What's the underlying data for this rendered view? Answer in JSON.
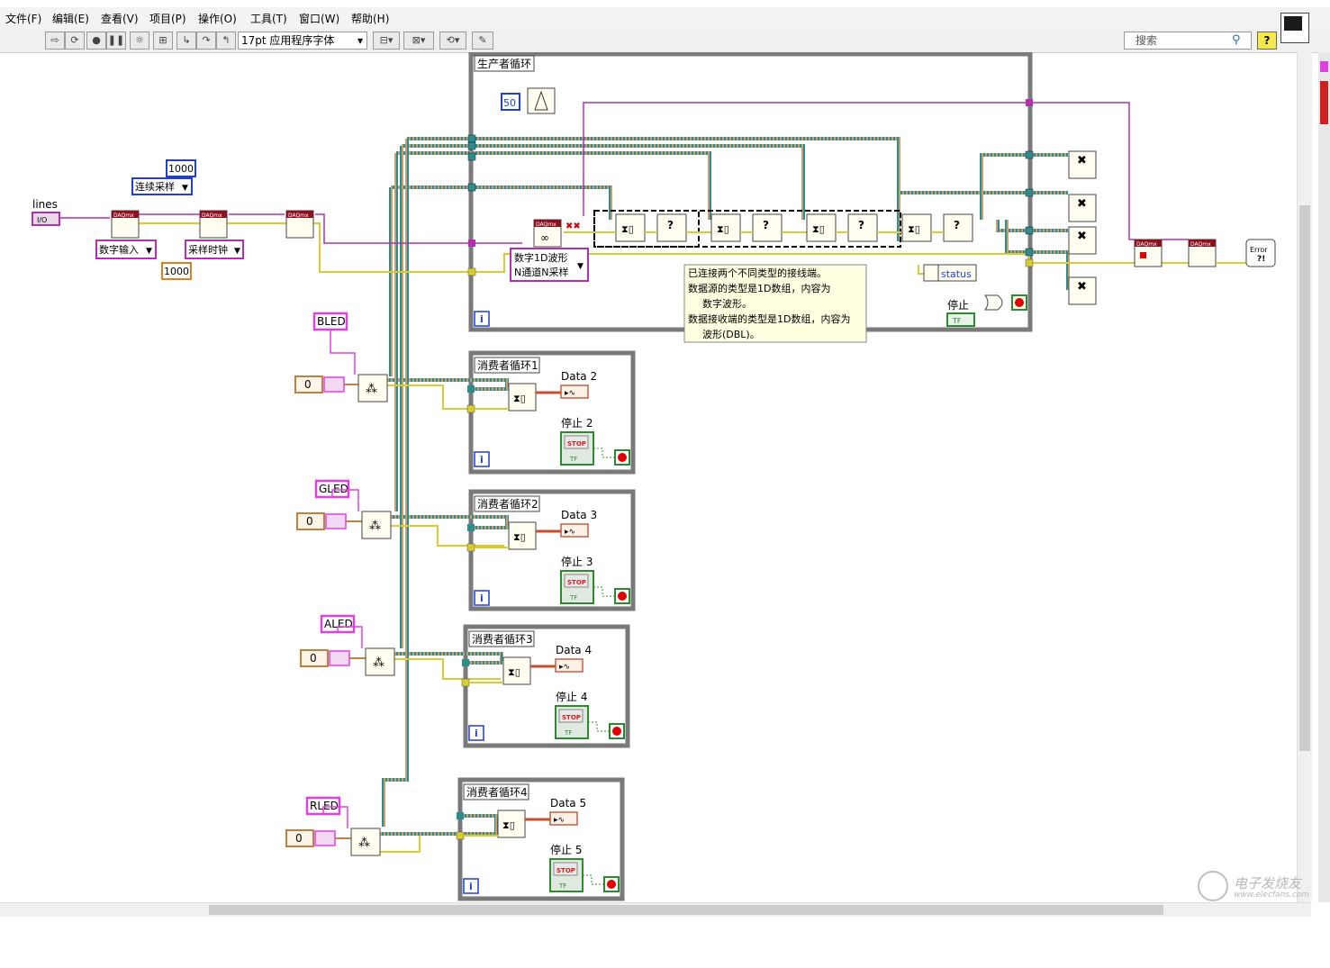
{
  "window": {
    "title": ""
  },
  "menus": [
    "文件(F)",
    "编辑(E)",
    "查看(V)",
    "项目(P)",
    "操作(O)",
    "工具(T)",
    "窗口(W)",
    "帮助(H)"
  ],
  "toolbar": {
    "font_select": "17pt 应用程序字体",
    "search_placeholder": "搜索",
    "help": "?"
  },
  "diagram": {
    "controls": {
      "lines": "lines",
      "samples_1000_top": "1000",
      "continuous_sampling": "连续采样",
      "digital_input": "数字输入",
      "sample_clock": "采样时钟",
      "samples_1000_bottom": "1000",
      "wait_ms": "50",
      "read_mode": [
        "数字1D波形",
        "N通道N采样"
      ],
      "status": "status",
      "stop_main": "停止",
      "tf": "TF",
      "daqmx": "DAQmx",
      "error": "Error",
      "iter": "i",
      "stop_btn": "STOP"
    },
    "io_strings": [
      "BLED",
      "GLED",
      "ALED",
      "RLED"
    ],
    "numeric_zero": "0",
    "producer": {
      "label": "生产者循环"
    },
    "tooltip": {
      "lines": [
        "已连接两个不同类型的接线端。",
        "数据源的类型是1D数组，内容为",
        "数字波形。",
        "数据接收端的类型是1D数组，内容为",
        "波形(DBL)。"
      ]
    },
    "consumers": [
      {
        "label": "消费者循环1",
        "data": "Data 2",
        "stop": "停止 2"
      },
      {
        "label": "消费者循环2",
        "data": "Data 3",
        "stop": "停止 3"
      },
      {
        "label": "消费者循环3",
        "data": "Data 4",
        "stop": "停止 4"
      },
      {
        "label": "消费者循环4",
        "data": "Data 5",
        "stop": "停止 5"
      }
    ]
  },
  "watermark": {
    "cn": "电子发烧友",
    "url": "www.elecfans.com"
  },
  "colors": {
    "io_purple": "#b030b0",
    "ref_teal": "#2f8c8c",
    "error_yellow": "#d8cc30",
    "numeric_blue": "#1f3fd0",
    "string_pink": "#e040e0",
    "loop_gray": "#7a7a7a",
    "tooltip_bg": "#ffffe1",
    "stop_green": "#2e8a2e",
    "node_bg": "#fffef0"
  }
}
